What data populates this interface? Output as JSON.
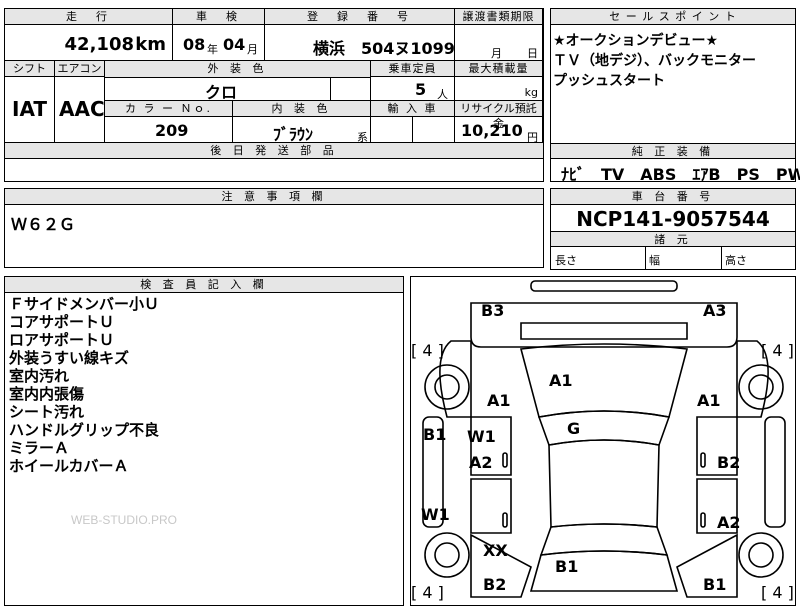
{
  "top": {
    "headers": {
      "mileage": "走　行",
      "inspection": "車　検",
      "registration": "登　録　番　号",
      "transfer_deadline": "譲渡書類期限",
      "sales_point": "セ ー ル ス ポ イ ン ト"
    },
    "mileage_value": "42,108",
    "mileage_unit": "km",
    "inspection_year": "08",
    "inspection_year_unit": "年",
    "inspection_month": "04",
    "inspection_month_unit": "月",
    "registration_number": "横浜　504ヌ1099",
    "transfer_month_unit": "月",
    "transfer_day_unit": "日"
  },
  "row2": {
    "headers": {
      "shift": "シフト",
      "aircon": "エアコン",
      "exterior_color": "外 装 色",
      "capacity": "乗車定員",
      "max_load": "最大積載量"
    },
    "shift_value": "IAT",
    "aircon_value": "AAC",
    "exterior_color_value": "クロ",
    "capacity_value": "5",
    "capacity_unit": "人",
    "max_load_unit": "kg",
    "headers2": {
      "color_no": "カ ラ ー Ｎｏ.",
      "interior_color": "内 装 色",
      "import": "輸 入 車",
      "recycle": "リサイクル預託金"
    },
    "color_no_value": "209",
    "interior_color_value": "ﾌﾞﾗｳﾝ",
    "interior_color_suffix": "系",
    "recycle_value": "10,210",
    "recycle_unit": "円",
    "later_parts_header": "後 日 発 送 部 品"
  },
  "sales_points": {
    "line1": "★オークションデビュー★",
    "line2": "ＴＶ（地デジ）、バックモニター",
    "line3": "プッシュスタート"
  },
  "equipment": {
    "header": "純 正 装 備",
    "items": "ﾅﾋﾞ　TV　ABS　ｴｱB　PS　PW"
  },
  "caution": {
    "header": "注 意 事 項 欄",
    "value": "Ｗ６２Ｇ"
  },
  "chassis": {
    "header": "車 台 番 号",
    "value": "NCP141-9057544",
    "dims_header": "諸 元",
    "length_label": "長さ",
    "width_label": "幅",
    "height_label": "高さ"
  },
  "inspector": {
    "header": "検 査 員 記 入 欄",
    "notes": [
      "Ｆサイドメンバー小Ｕ",
      "コアサポートＵ",
      "ロアサポートＵ",
      "外装うすい線キズ",
      "室内汚れ",
      "室内内張傷",
      "シート汚れ",
      "ハンドルグリップ不良",
      "ミラーＡ",
      "ホイールカバーＡ"
    ],
    "watermark": "WEB-STUDIO.PRO"
  },
  "diagram": {
    "labels": {
      "b3": "B3",
      "a3": "A3",
      "tyre_fl": "[ 4 ]",
      "tyre_fr": "[ 4 ]",
      "tyre_rl": "[ 4 ]",
      "tyre_rr": "[ 4 ]",
      "hood": "A1",
      "fl_fender": "A1",
      "fr_fender": "A1",
      "roof": "G",
      "left_sill": "B1",
      "fl_door": "W1",
      "fl_door2": "A2",
      "fr_door": "B2",
      "rl_sill": "W1",
      "rr_door": "A2",
      "rl_quarter": "XX",
      "rear_left": "B2",
      "trunk": "B1",
      "rear_right": "B1"
    }
  }
}
